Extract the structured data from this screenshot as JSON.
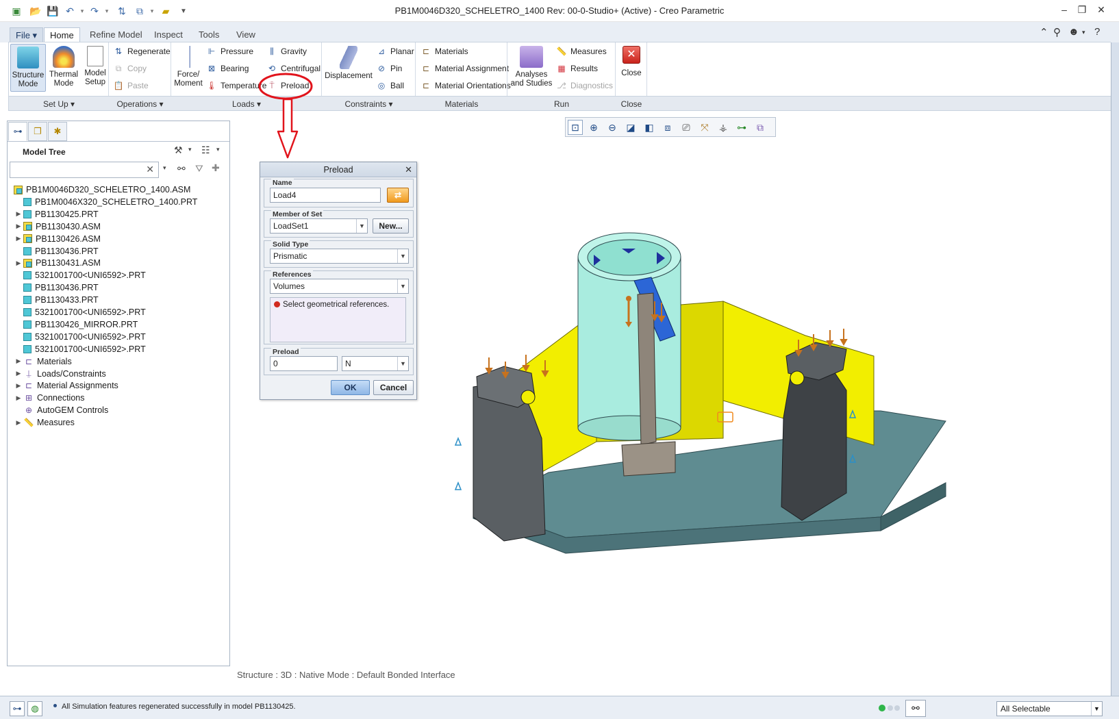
{
  "window": {
    "title": "PB1M0046D320_SCHELETRO_1400 Rev: 00-0-Studio+ (Active) - Creo Parametric",
    "controls": [
      "–",
      "❐",
      "✕"
    ]
  },
  "ribbon": {
    "tabs": [
      {
        "label": "File ▾",
        "id": "file"
      },
      {
        "label": "Home",
        "id": "home"
      },
      {
        "label": "Refine Model",
        "id": "refine-model"
      },
      {
        "label": "Inspect",
        "id": "inspect"
      },
      {
        "label": "Tools",
        "id": "tools"
      },
      {
        "label": "View",
        "id": "view"
      }
    ],
    "active_tab": "Home",
    "groups": {
      "setup": {
        "label": "Set Up ▾",
        "structure_mode": "Structure\nMode",
        "thermal_mode": "Thermal\nMode",
        "model_setup": "Model\nSetup"
      },
      "operations": {
        "label": "Operations ▾",
        "regenerate": "Regenerate",
        "copy": "Copy",
        "paste": "Paste"
      },
      "loads": {
        "label": "Loads ▾",
        "force_moment": "Force/\nMoment",
        "pressure": "Pressure",
        "bearing": "Bearing",
        "temperature": "Temperature",
        "gravity": "Gravity",
        "centrifugal": "Centrifugal",
        "preload": "Preload"
      },
      "constraints": {
        "label": "Constraints ▾",
        "displacement": "Displacement",
        "planar": "Planar",
        "pin": "Pin",
        "ball": "Ball"
      },
      "materials": {
        "label": "Materials",
        "materials": "Materials",
        "material_assignment": "Material Assignment",
        "material_orientations": "Material Orientations"
      },
      "run": {
        "label": "Run",
        "analyses": "Analyses\nand Studies",
        "measures": "Measures",
        "results": "Results",
        "diagnostics": "Diagnostics"
      },
      "close": {
        "label": "Close",
        "close": "Close"
      }
    }
  },
  "model_tree": {
    "title": "Model Tree",
    "search_placeholder": "",
    "items": [
      {
        "label": "PB1M0046D320_SCHELETRO_1400.ASM",
        "type": "asm",
        "expander": "",
        "level": 0
      },
      {
        "label": "PB1M0046X320_SCHELETRO_1400.PRT",
        "type": "prt",
        "expander": "",
        "level": 1
      },
      {
        "label": "PB1130425.PRT",
        "type": "prt",
        "expander": "▶",
        "level": 1
      },
      {
        "label": "PB1130430.ASM",
        "type": "asm",
        "expander": "▶",
        "level": 1
      },
      {
        "label": "PB1130426.ASM",
        "type": "asm",
        "expander": "▶",
        "level": 1
      },
      {
        "label": "PB1130436.PRT",
        "type": "prt",
        "expander": "",
        "level": 1
      },
      {
        "label": "PB1130431.ASM",
        "type": "asm",
        "expander": "▶",
        "level": 1
      },
      {
        "label": "5321001700<UNI6592>.PRT",
        "type": "prt",
        "expander": "",
        "level": 1
      },
      {
        "label": "PB1130436.PRT",
        "type": "prt",
        "expander": "",
        "level": 1
      },
      {
        "label": "PB1130433.PRT",
        "type": "prt",
        "expander": "",
        "level": 1
      },
      {
        "label": "5321001700<UNI6592>.PRT",
        "type": "prt",
        "expander": "",
        "level": 1
      },
      {
        "label": "PB1130426_MIRROR.PRT",
        "type": "prt",
        "expander": "",
        "level": 1
      },
      {
        "label": "5321001700<UNI6592>.PRT",
        "type": "prt",
        "expander": "",
        "level": 1
      },
      {
        "label": "5321001700<UNI6592>.PRT",
        "type": "prt",
        "expander": "",
        "level": 1
      },
      {
        "label": "Materials",
        "type": "materials",
        "expander": "▶",
        "level": 1
      },
      {
        "label": "Loads/Constraints",
        "type": "loads",
        "expander": "▶",
        "level": 1
      },
      {
        "label": "Material Assignments",
        "type": "matassign",
        "expander": "▶",
        "level": 1
      },
      {
        "label": "Connections",
        "type": "connections",
        "expander": "▶",
        "level": 1
      },
      {
        "label": "AutoGEM Controls",
        "type": "autogem",
        "expander": "",
        "level": 1
      },
      {
        "label": "Measures",
        "type": "measures",
        "expander": "▶",
        "level": 1
      }
    ]
  },
  "dialog": {
    "title": "Preload",
    "name_label": "Name",
    "name_value": "Load4",
    "member_label": "Member of Set",
    "member_value": "LoadSet1",
    "new_button": "New...",
    "solid_type_label": "Solid Type",
    "solid_type_value": "Prismatic",
    "references_label": "References",
    "references_value": "Volumes",
    "references_hint": "Select geometrical references.",
    "preload_label": "Preload",
    "preload_value": "0",
    "preload_unit": "N",
    "ok": "OK",
    "cancel": "Cancel"
  },
  "graphics": {
    "status_text": "Structure : 3D : Native Mode : Default Bonded Interface"
  },
  "statusbar": {
    "message": "All Simulation features regenerated successfully in model PB1130425.",
    "selection_filter": "All Selectable"
  },
  "colors": {
    "annotation_red": "#e1141c",
    "model_yellow": "#f2ee00",
    "model_cyan": "#a9ecdf",
    "model_base": "#5f8c91",
    "load_arrow": "#c7721e"
  }
}
